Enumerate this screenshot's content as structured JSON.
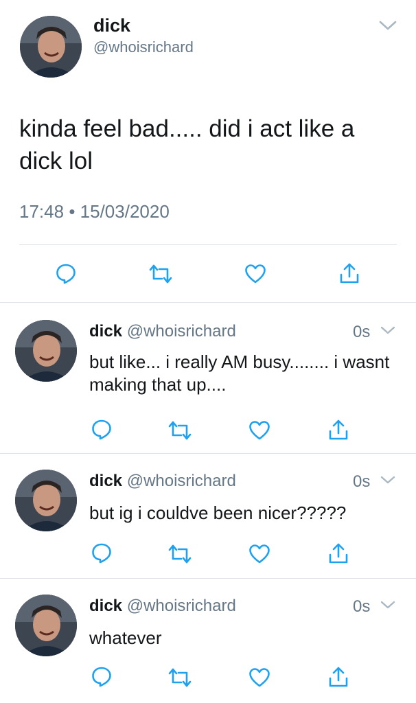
{
  "main_tweet": {
    "name": "dick",
    "handle": "@whoisrichard",
    "text": "kinda feel bad..... did i act like a dick lol",
    "time": "17:48",
    "separator": "•",
    "date": "15/03/2020"
  },
  "replies": [
    {
      "name": "dick",
      "handle": "@whoisrichard",
      "time": "0s",
      "text": "but like... i really AM busy........ i wasnt making that up...."
    },
    {
      "name": "dick",
      "handle": "@whoisrichard",
      "time": "0s",
      "text": "but ig i couldve been nicer?????"
    },
    {
      "name": "dick",
      "handle": "@whoisrichard",
      "time": "0s",
      "text": "whatever"
    }
  ],
  "icons": {
    "reply": "reply-icon",
    "retweet": "retweet-icon",
    "like": "heart-icon",
    "share": "share-icon",
    "menu": "chevron-down-icon"
  },
  "colors": {
    "text": "#14171a",
    "secondary": "#657786",
    "icon": "#1da1f2",
    "divider": "#dfe3e7"
  }
}
